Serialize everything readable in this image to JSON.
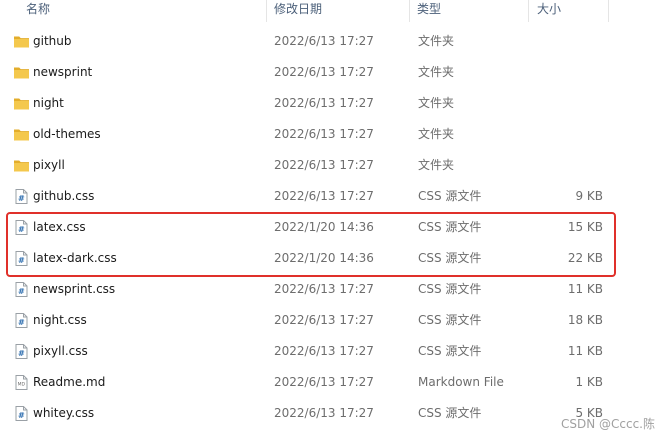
{
  "columns": {
    "name": "名称",
    "date": "修改日期",
    "type": "类型",
    "size": "大小"
  },
  "files": [
    {
      "name": "github",
      "date": "2022/6/13 17:27",
      "type": "文件夹",
      "size": "",
      "icon": "folder-icon"
    },
    {
      "name": "newsprint",
      "date": "2022/6/13 17:27",
      "type": "文件夹",
      "size": "",
      "icon": "folder-icon"
    },
    {
      "name": "night",
      "date": "2022/6/13 17:27",
      "type": "文件夹",
      "size": "",
      "icon": "folder-icon"
    },
    {
      "name": "old-themes",
      "date": "2022/6/13 17:27",
      "type": "文件夹",
      "size": "",
      "icon": "folder-icon"
    },
    {
      "name": "pixyll",
      "date": "2022/6/13 17:27",
      "type": "文件夹",
      "size": "",
      "icon": "folder-icon"
    },
    {
      "name": "github.css",
      "date": "2022/6/13 17:27",
      "type": "CSS 源文件",
      "size": "9 KB",
      "icon": "css-file-icon"
    },
    {
      "name": "latex.css",
      "date": "2022/1/20 14:36",
      "type": "CSS 源文件",
      "size": "15 KB",
      "icon": "css-file-icon"
    },
    {
      "name": "latex-dark.css",
      "date": "2022/1/20 14:36",
      "type": "CSS 源文件",
      "size": "22 KB",
      "icon": "css-file-icon"
    },
    {
      "name": "newsprint.css",
      "date": "2022/6/13 17:27",
      "type": "CSS 源文件",
      "size": "11 KB",
      "icon": "css-file-icon"
    },
    {
      "name": "night.css",
      "date": "2022/6/13 17:27",
      "type": "CSS 源文件",
      "size": "18 KB",
      "icon": "css-file-icon"
    },
    {
      "name": "pixyll.css",
      "date": "2022/6/13 17:27",
      "type": "CSS 源文件",
      "size": "11 KB",
      "icon": "css-file-icon"
    },
    {
      "name": "Readme.md",
      "date": "2022/6/13 17:27",
      "type": "Markdown File",
      "size": "1 KB",
      "icon": "markdown-file-icon"
    },
    {
      "name": "whitey.css",
      "date": "2022/6/13 17:27",
      "type": "CSS 源文件",
      "size": "5 KB",
      "icon": "css-file-icon"
    }
  ],
  "watermark": "CSDN @Cccc.陈",
  "colors": {
    "folder": "#f4c84d",
    "folder_dark": "#e3ad2b",
    "highlight": "#e0302a",
    "header_text": "#4c607a"
  }
}
